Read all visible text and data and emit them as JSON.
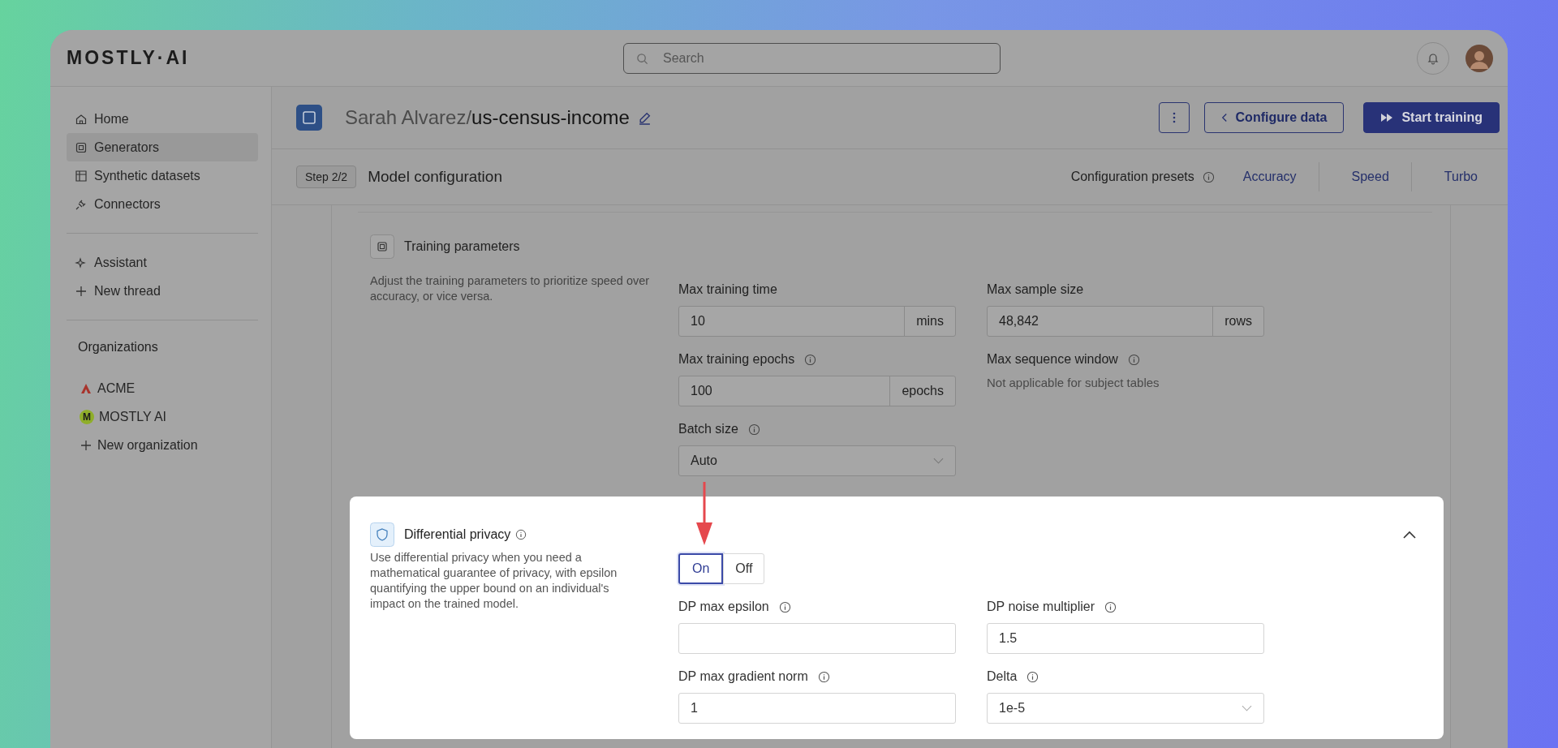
{
  "topbar": {
    "logo": "MOSTLY·AI",
    "search": {
      "placeholder": "Search"
    }
  },
  "sidebar": {
    "nav": [
      {
        "label": "Home",
        "kind": "home",
        "selected": false
      },
      {
        "label": "Generators",
        "kind": "generator",
        "selected": true
      },
      {
        "label": "Synthetic datasets",
        "kind": "table",
        "selected": false
      },
      {
        "label": "Connectors",
        "kind": "plug",
        "selected": false
      }
    ],
    "assistant": [
      {
        "label": "Assistant",
        "kind": "sparkle"
      },
      {
        "label": "New thread",
        "kind": "plus"
      }
    ],
    "organizations_title": "Organizations",
    "organizations": [
      {
        "label": "ACME",
        "kind": "logo"
      },
      {
        "label": "MOSTLY AI",
        "kind": "badge",
        "badge": "M"
      },
      {
        "label": "New organization",
        "kind": "add"
      }
    ]
  },
  "header": {
    "owner": "Sarah Alvarez/",
    "name": "us-census-income",
    "buttons": [
      {
        "label": "Configure data",
        "kind": "secondary"
      },
      {
        "label": "Start training",
        "kind": "primary"
      }
    ]
  },
  "step": {
    "badge": "Step 2/2",
    "title": "Model configuration",
    "presets_label": "Configuration presets",
    "presets": [
      "Accuracy",
      "Speed",
      "Turbo"
    ]
  },
  "training": {
    "title": "Training parameters",
    "description": "Adjust the training parameters to prioritize speed over accuracy, or vice versa.",
    "fields": [
      {
        "label": "Max training time",
        "kind": "unit",
        "value": "10",
        "unit": "mins",
        "info": false
      },
      {
        "label": "Max sample size",
        "kind": "unit",
        "value": "48,842",
        "unit": "rows",
        "info": false
      },
      {
        "label": "Max training epochs",
        "kind": "unit",
        "value": "100",
        "unit": "epochs",
        "info": true
      },
      {
        "label": "Max sequence window",
        "kind": "note",
        "note": "Not applicable for subject tables",
        "info": true
      },
      {
        "label": "Batch size",
        "kind": "select",
        "value": "Auto",
        "info": true
      }
    ]
  },
  "privacy": {
    "title": "Differential privacy",
    "title_info": true,
    "expanded": true,
    "description": "Use differential privacy when you need a mathematical guarantee of privacy, with epsilon quantifying the upper bound on an individual's impact on the trained model.",
    "toggle": [
      {
        "label": "On",
        "selected": true
      },
      {
        "label": "Off",
        "selected": false
      }
    ],
    "fields": [
      {
        "label": "DP max epsilon",
        "kind": "text",
        "info": true
      },
      {
        "label": "DP noise multiplier",
        "kind": "text",
        "value": "1.5",
        "info": true
      },
      {
        "label": "DP max gradient norm",
        "kind": "text",
        "value": "1",
        "info": true
      },
      {
        "label": "Delta",
        "kind": "select",
        "value": "1e-5",
        "info": true
      }
    ]
  }
}
